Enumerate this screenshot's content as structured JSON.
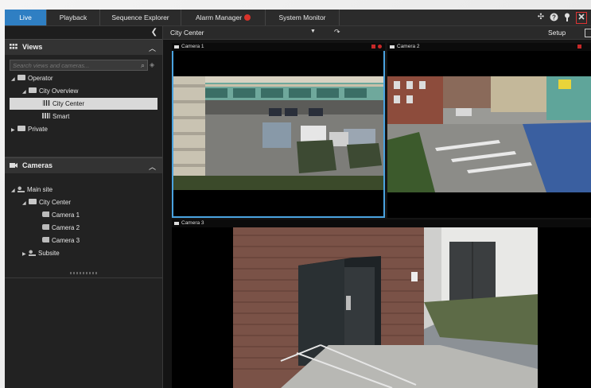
{
  "tabs": [
    {
      "label": "Live",
      "active": true
    },
    {
      "label": "Playback",
      "active": false
    },
    {
      "label": "Sequence Explorer",
      "active": false
    },
    {
      "label": "Alarm Manager",
      "active": false,
      "badge": true
    },
    {
      "label": "System Monitor",
      "active": false
    }
  ],
  "top_icons": [
    "pin-icon",
    "help-icon",
    "key-icon",
    "close-icon"
  ],
  "views": {
    "title": "Views",
    "search_placeholder": "Search views and cameras...",
    "tree": [
      {
        "label": "Operator",
        "level": 0,
        "type": "folder",
        "expanded": true
      },
      {
        "label": "City Overview",
        "level": 1,
        "type": "folder",
        "expanded": true
      },
      {
        "label": "City Center",
        "level": 2,
        "type": "view",
        "selected": true
      },
      {
        "label": "Smart",
        "level": 2,
        "type": "view"
      },
      {
        "label": "Private",
        "level": 0,
        "type": "folder",
        "expanded": false
      }
    ]
  },
  "cameras": {
    "title": "Cameras",
    "tree": [
      {
        "label": "Main site",
        "level": 0,
        "type": "site"
      },
      {
        "label": "City Center",
        "level": 1,
        "type": "folder"
      },
      {
        "label": "Camera 1",
        "level": 2,
        "type": "camera"
      },
      {
        "label": "Camera 2",
        "level": 2,
        "type": "camera"
      },
      {
        "label": "Camera 3",
        "level": 2,
        "type": "camera"
      },
      {
        "label": "Subsite",
        "level": 1,
        "type": "site"
      }
    ]
  },
  "toolbar": {
    "view_name": "City Center",
    "setup_label": "Setup"
  },
  "tiles": [
    {
      "label": "Camera 1"
    },
    {
      "label": "Camera 2"
    },
    {
      "label": "Camera 3"
    }
  ],
  "colors": {
    "accent": "#2f7fc3",
    "selection_border": "#4aa3e0",
    "alert": "#d9332b"
  }
}
